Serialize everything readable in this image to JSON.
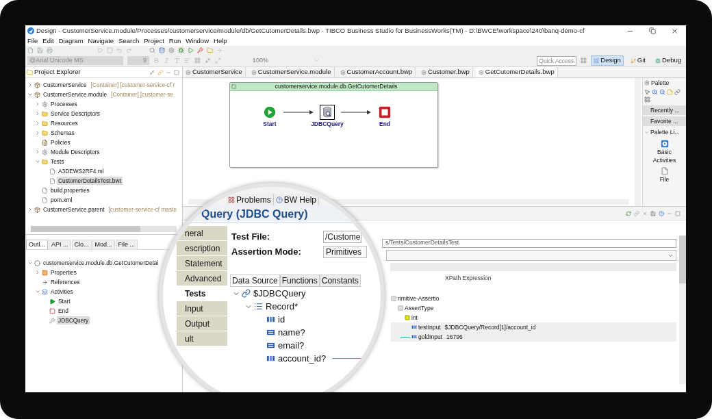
{
  "window": {
    "title": "Design - CustomerService.module/Processes/customerservice/module/db/GetCutomerDetails.bwp - TIBCO Business Studio for BusinessWorks(TM) - D:\\BWCE\\workspace\\240\\banq-demo-cf"
  },
  "menu": [
    "File",
    "Edit",
    "Diagram",
    "Navigate",
    "Search",
    "Project",
    "Run",
    "Window",
    "Help"
  ],
  "toolbar": {
    "font": "@Arial Unicode MS",
    "font_size": "9",
    "zoom": "100%",
    "quick_access": {
      "placeholder": "Quick Access"
    },
    "perspectives": [
      {
        "label": "Design",
        "selected": true
      },
      {
        "label": "Git",
        "selected": false
      },
      {
        "label": "Debug",
        "selected": false
      }
    ]
  },
  "project_explorer": {
    "title": "Project Explorer",
    "items": [
      {
        "label": "CustomerService",
        "decoration": "[Container] [customer-service-cf r",
        "kind": "project",
        "expanded": false,
        "selected": false
      },
      {
        "label": "CustomerService.module",
        "decoration": "[Container] [customer-se",
        "kind": "project",
        "expanded": true,
        "selected": false,
        "children": [
          {
            "label": "Processes",
            "kind": "gear",
            "expanded": false,
            "selected": false
          },
          {
            "label": "Service Descriptors",
            "kind": "folder",
            "expanded": false,
            "selected": false
          },
          {
            "label": "Resources",
            "kind": "folder",
            "expanded": false,
            "selected": false
          },
          {
            "label": "Schemas",
            "kind": "folder",
            "expanded": false,
            "selected": false
          },
          {
            "label": "Policies",
            "kind": "document",
            "selected": false
          },
          {
            "label": "Module Descriptors",
            "kind": "gear",
            "expanded": false,
            "selected": false
          },
          {
            "label": "Tests",
            "kind": "folder",
            "expanded": true,
            "selected": false,
            "children": [
              {
                "label": "A3DEWS2RF4.ml",
                "kind": "file",
                "selected": false
              },
              {
                "label": "CustomerDetailsTest.bwt",
                "kind": "file",
                "selected": true
              }
            ]
          },
          {
            "label": "build.properties",
            "kind": "file",
            "selected": false
          },
          {
            "label": "pom.xml",
            "kind": "file",
            "selected": false
          }
        ]
      },
      {
        "label": "CustomerService.parent",
        "decoration": "[customer-service-cf maste",
        "kind": "project",
        "expanded": false,
        "selected": false
      }
    ]
  },
  "outline": {
    "tabs": [
      {
        "label": "Outl...",
        "selected": true
      },
      {
        "label": "API ...",
        "selected": false
      },
      {
        "label": "Clo...",
        "selected": false
      },
      {
        "label": "Mod...",
        "selected": false
      },
      {
        "label": "File ...",
        "selected": false
      }
    ],
    "items": [
      {
        "label": "customerservice.module.db.GetCutomerDetai",
        "kind": "process",
        "expanded": true,
        "selected": false,
        "children": [
          {
            "label": "Properties",
            "kind": "properties",
            "expanded": false,
            "selected": false
          },
          {
            "label": "References",
            "kind": "references",
            "selected": false
          },
          {
            "label": "Activities",
            "kind": "activities",
            "expanded": true,
            "selected": false,
            "children": [
              {
                "label": "Start",
                "kind": "start",
                "selected": false
              },
              {
                "label": "End",
                "kind": "end",
                "selected": false
              },
              {
                "label": "JDBCQuery",
                "kind": "activity",
                "selected": true
              }
            ]
          }
        ]
      }
    ]
  },
  "editor": {
    "tabs": [
      {
        "label": "CustomerService",
        "selected": false
      },
      {
        "label": "CustomerService.module",
        "selected": false
      },
      {
        "label": "CustomerAccount.bwp",
        "selected": false
      },
      {
        "label": "Customer.bwp",
        "selected": false
      },
      {
        "label": "GetCutomerDetails.bwp",
        "selected": true
      }
    ],
    "process": {
      "title": "customerservice.module.db.GetCutomerDetails",
      "activities": [
        {
          "label": "Start",
          "kind": "start",
          "selected": false
        },
        {
          "label": "JDBCQuery",
          "kind": "jdbc",
          "selected": true
        },
        {
          "label": "End",
          "kind": "end",
          "selected": false
        }
      ]
    }
  },
  "palette": {
    "title": "Palette",
    "sections": [
      {
        "label": "Recently ...",
        "expanded": false
      },
      {
        "label": "Favorite ...",
        "expanded": false
      },
      {
        "label": "Palette Li...",
        "expanded": true
      }
    ],
    "items": [
      {
        "label": "Basic Activities",
        "kind": "play"
      },
      {
        "label": "File",
        "kind": "file"
      }
    ]
  },
  "properties": {
    "tabs": [
      {
        "label": "Problems",
        "selected": false
      },
      {
        "label": "BW Help",
        "selected": false
      }
    ],
    "title": "Query (JDBC Query)",
    "side_tabs": [
      {
        "label": "neral",
        "selected": false
      },
      {
        "label": "escription",
        "selected": false
      },
      {
        "label": "Statement",
        "selected": false
      },
      {
        "label": "Advanced",
        "selected": false
      },
      {
        "label": "Tests",
        "selected": true
      },
      {
        "label": "Input",
        "selected": false
      },
      {
        "label": "Output",
        "selected": false
      },
      {
        "label": "ult",
        "selected": false
      }
    ],
    "test_file": {
      "label": "Test File:",
      "value_in_lens": "/Custome",
      "value": "s/Tests/CustomerDetailsTest"
    },
    "assertion_mode": {
      "label": "Assertion Mode:",
      "value": "Primitives"
    },
    "source_tabs": [
      {
        "label": "Data Source",
        "selected": true
      },
      {
        "label": "Functions",
        "selected": false
      },
      {
        "label": "Constants",
        "selected": false
      }
    ],
    "source_tree": [
      {
        "label": "$JDBCQuery",
        "kind": "root",
        "expanded": true,
        "selected": false,
        "children": [
          {
            "label": "Record*",
            "kind": "record",
            "expanded": true,
            "selected": false,
            "children": [
              {
                "label": "id",
                "kind": "number",
                "selected": false
              },
              {
                "label": "name?",
                "kind": "text",
                "selected": false
              },
              {
                "label": "email?",
                "kind": "text",
                "selected": false
              },
              {
                "label": "account_id?",
                "kind": "number",
                "selected": false,
                "mapped": true
              }
            ]
          }
        ]
      }
    ],
    "xpath": {
      "heading": "XPath Expression",
      "rows": [
        {
          "label": "rimitive-Assertio",
          "kind": "group",
          "children": [
            {
              "label": "AssertType",
              "kind": "group",
              "children": [
                {
                  "label": "int",
                  "kind": "type",
                  "children": [
                    {
                      "label": "testInput",
                      "kind": "number",
                      "value": "$JDBCQuery/Record[1]/account_id",
                      "mapped": false
                    },
                    {
                      "label": "goldInput",
                      "kind": "number",
                      "value": "16796",
                      "mapped": true
                    }
                  ]
                }
              ]
            }
          ]
        }
      ]
    }
  }
}
